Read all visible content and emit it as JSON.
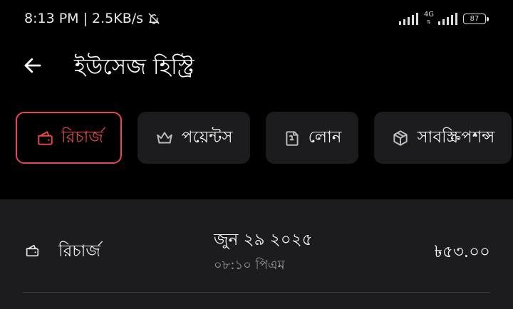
{
  "status": {
    "time_text": "8:13 PM | 2.5KB/s",
    "network_type": "4G",
    "battery": "87",
    "mute_icon": "bell-off-icon"
  },
  "header": {
    "back_icon": "arrow-left-icon",
    "title": "ইউসেজ হিস্ট্রি"
  },
  "tabs": [
    {
      "label": "রিচার্জ",
      "icon": "wallet-icon",
      "active": true
    },
    {
      "label": "পয়েন্টস",
      "icon": "crown-icon",
      "active": false
    },
    {
      "label": "লোন",
      "icon": "loan-icon",
      "active": false
    },
    {
      "label": "সাবস্ক্রিপশন্স",
      "icon": "box-icon",
      "active": false
    }
  ],
  "transactions": [
    {
      "type": "রিচার্জ",
      "icon": "wallet-icon",
      "date": "জুন ২৯ ২০২৫",
      "time": "০৮:১০ পিএম",
      "amount": "৳৫৩.০০"
    }
  ],
  "colors": {
    "accent": "#e5484d",
    "background": "#000000",
    "surface": "#1c1c1e"
  }
}
